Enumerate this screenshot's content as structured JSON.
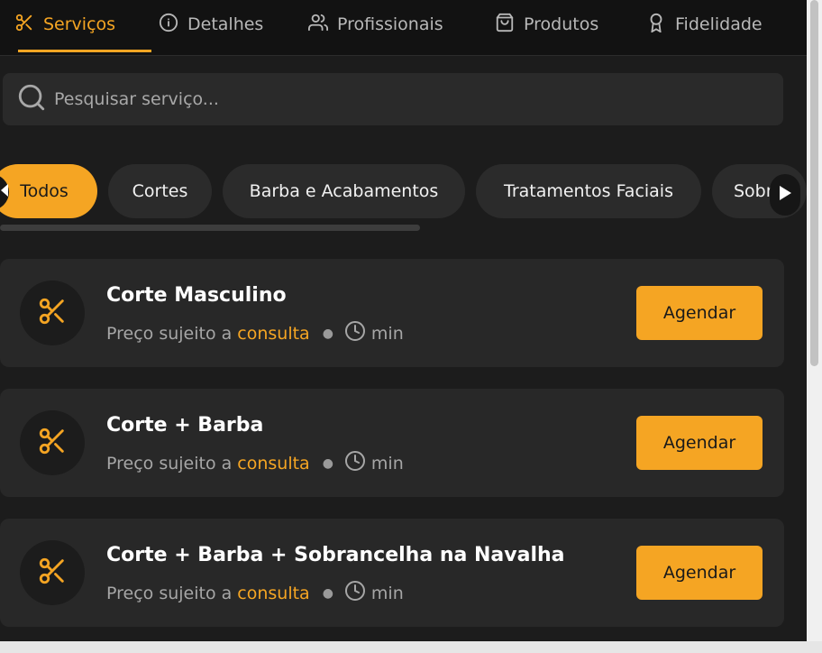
{
  "tabs": [
    {
      "label": "Serviços",
      "icon": "scissors-icon",
      "active": true
    },
    {
      "label": "Detalhes",
      "icon": "info-icon",
      "active": false
    },
    {
      "label": "Profissionais",
      "icon": "users-icon",
      "active": false
    },
    {
      "label": "Produtos",
      "icon": "shopping-bag-icon",
      "active": false
    },
    {
      "label": "Fidelidade",
      "icon": "award-icon",
      "active": false
    }
  ],
  "search": {
    "placeholder": "Pesquisar serviço..."
  },
  "categories": [
    {
      "label": "Todos",
      "active": true
    },
    {
      "label": "Cortes",
      "active": false
    },
    {
      "label": "Barba e Acabamentos",
      "active": false
    },
    {
      "label": "Tratamentos Faciais",
      "active": false
    },
    {
      "label": "Sobr",
      "active": false
    }
  ],
  "services": [
    {
      "name": "Corte Masculino",
      "price_prefix": "Preço sujeito a",
      "price_accent": "consulta",
      "duration": "min",
      "button": "Agendar"
    },
    {
      "name": "Corte + Barba",
      "price_prefix": "Preço sujeito a",
      "price_accent": "consulta",
      "duration": "min",
      "button": "Agendar"
    },
    {
      "name": "Corte + Barba + Sobrancelha na Navalha",
      "price_prefix": "Preço sujeito a",
      "price_accent": "consulta",
      "duration": "min",
      "button": "Agendar"
    }
  ],
  "colors": {
    "accent": "#f5a523",
    "background": "#1c1c1c",
    "card": "#282828"
  }
}
